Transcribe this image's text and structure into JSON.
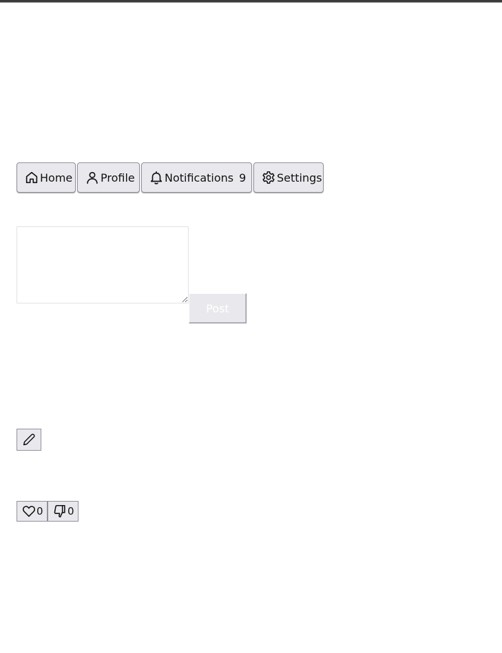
{
  "nav": {
    "home_label": "Home",
    "profile_label": "Profile",
    "notifications_label": "Notifications",
    "notifications_count": "9",
    "settings_label": "Settings",
    "icons": [
      "home-icon",
      "user-icon",
      "bell-icon",
      "gear-icon"
    ]
  },
  "composer": {
    "text_value": "",
    "post_label": "Post"
  },
  "edit": {
    "icon": "pencil-icon"
  },
  "reactions": {
    "like_count": "0",
    "dislike_count": "0",
    "icons": [
      "heart-icon",
      "thumbs-down-icon"
    ]
  },
  "colors": {
    "button_bg": "#e9e9ed",
    "button_border": "#8f8f9d",
    "top_border": "#3a3a3a"
  }
}
